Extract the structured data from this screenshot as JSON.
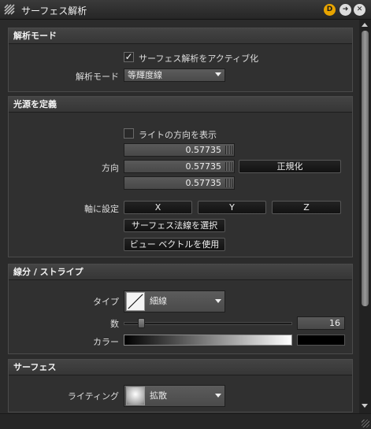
{
  "window": {
    "title": "サーフェス解析"
  },
  "panel1": {
    "header": "解析モード",
    "activate_label": "サーフェス解析をアクティブ化",
    "mode_label": "解析モード",
    "mode_value": "等輝度線"
  },
  "panel2": {
    "header": "光源を定義",
    "show_dir_label": "ライトの方向を表示",
    "direction_label": "方向",
    "direction_values": [
      "0.57735",
      "0.57735",
      "0.57735"
    ],
    "normalize_label": "正規化",
    "axis_label": "軸に設定",
    "axis_x": "X",
    "axis_y": "Y",
    "axis_z": "Z",
    "select_normal_label": "サーフェス法線を選択",
    "use_view_label": "ビュー ベクトルを使用"
  },
  "panel3": {
    "header": "線分 / ストライプ",
    "type_label": "タイプ",
    "type_value": "細線",
    "count_label": "数",
    "count_value": "16",
    "count_fraction": 0.04,
    "color_label": "カラー"
  },
  "panel4": {
    "header": "サーフェス",
    "lighting_label": "ライティング",
    "lighting_value": "拡散"
  },
  "colors": {
    "accent": "#e8a400",
    "panel": "#303030"
  }
}
